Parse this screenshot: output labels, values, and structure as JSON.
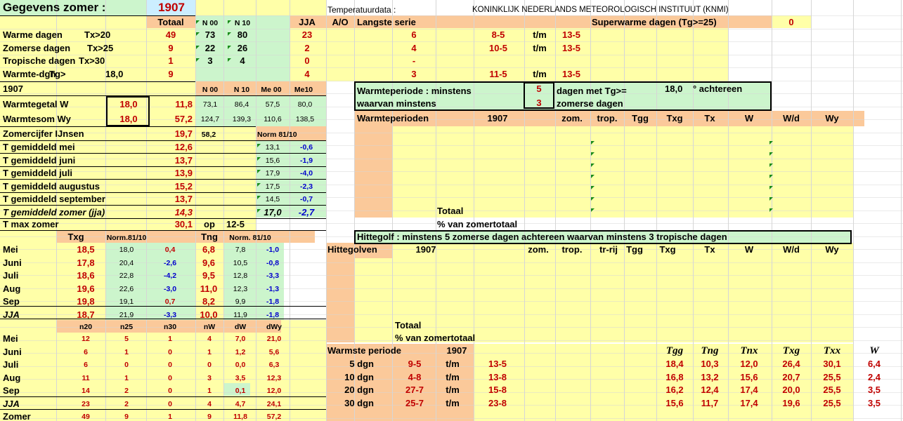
{
  "colors": {
    "yellow": "#ffffa8",
    "orange": "#fbc99a",
    "green": "#ccf5cc",
    "blue": "#cceeff",
    "red": "#c00000",
    "blue_text": "#0000cc"
  },
  "header": {
    "title": "Gegevens zomer :",
    "year": "1907",
    "temp_label": "Temperatuurdata :",
    "source": "KONINKLIJK NEDERLANDS METEOROLOGISCH INSTITUUT (KNMI)"
  },
  "col_heads": {
    "totaal": "Totaal",
    "n00": "N 00",
    "n10": "N 10",
    "jja": "JJA",
    "ao": "A/O",
    "langste": "Langste serie",
    "superwarm": "Superwarme dagen (Tg>=25)",
    "superwarm_val": "0"
  },
  "days": [
    {
      "label": "Warme dagen",
      "crit": "Tx>20",
      "tot": "49",
      "n00": "73",
      "n10": "80",
      "jja": "23",
      "ser": "6",
      "from": "8-5",
      "tm": "t/m",
      "to": "13-5"
    },
    {
      "label": "Zomerse dagen",
      "crit": "Tx>25",
      "tot": "9",
      "n00": "22",
      "n10": "26",
      "jja": "2",
      "ser": "4",
      "from": "10-5",
      "tm": "t/m",
      "to": "13-5"
    },
    {
      "label": "Tropische dagen",
      "crit": "Tx>30",
      "tot": "1",
      "n00": "3",
      "n10": "4",
      "jja": "0",
      "ser": "-",
      "from": "",
      "tm": "",
      "to": ""
    },
    {
      "label": "Warmte-dgn",
      "crit": "Tg>",
      "tot": "9",
      "n00": "",
      "n10": "",
      "jja": "4",
      "ser": "3",
      "from": "11-5",
      "tm": "t/m",
      "to": "13-5",
      "thr": "18,0"
    }
  ],
  "warmte": {
    "year": "1907",
    "h_n00": "N 00",
    "h_n10": "N 10",
    "h_me00": "Me 00",
    "h_me10": "Me10",
    "rows": [
      {
        "label": "Warmtegetal W",
        "box": "18,0",
        "val": "11,8",
        "n00": "73,1",
        "n10": "86,4",
        "me00": "57,5",
        "me10": "80,0"
      },
      {
        "label": "Warmtesom Wy",
        "box": "18,0",
        "val": "57,2",
        "n00": "124,7",
        "n10": "139,3",
        "me00": "110,6",
        "me10": "138,5"
      }
    ],
    "ijnsen_label": "Zomercijfer IJnsen",
    "ijnsen_val": "19,7",
    "ijnsen_n": "58,2",
    "norm": "Norm 81/10"
  },
  "tgem": [
    {
      "label": "T gemiddeld mei",
      "val": "12,6",
      "norm": "13,1",
      "diff": "-0,6"
    },
    {
      "label": "T gemiddeld juni",
      "val": "13,7",
      "norm": "15,6",
      "diff": "-1,9"
    },
    {
      "label": "T gemiddeld juli",
      "val": "13,9",
      "norm": "17,9",
      "diff": "-4,0"
    },
    {
      "label": "T gemiddeld augustus",
      "val": "15,2",
      "norm": "17,5",
      "diff": "-2,3"
    },
    {
      "label": "T gemiddeld september",
      "val": "13,7",
      "norm": "14,5",
      "diff": "-0,7"
    },
    {
      "label": "T gemiddeld zomer (jja)",
      "val": "14,3",
      "norm": "17,0",
      "diff": "-2,7"
    }
  ],
  "tmax": {
    "label": "T max zomer",
    "val": "30,1",
    "op": "op",
    "date": "12-5"
  },
  "monthly": {
    "h_txg": "Txg",
    "h_norm": "Norm.81/10",
    "h_tng": "Tng",
    "h_norm2": "Norm. 81/10",
    "rows": [
      {
        "m": "Mei",
        "txg": "18,5",
        "nx": "18,0",
        "dx": "0,4",
        "tng": "6,8",
        "nn": "7,8",
        "dn": "-1,0"
      },
      {
        "m": "Juni",
        "txg": "17,8",
        "nx": "20,4",
        "dx": "-2,6",
        "tng": "9,6",
        "nn": "10,5",
        "dn": "-0,8"
      },
      {
        "m": "Juli",
        "txg": "18,6",
        "nx": "22,8",
        "dx": "-4,2",
        "tng": "9,5",
        "nn": "12,8",
        "dn": "-3,3"
      },
      {
        "m": "Aug",
        "txg": "19,6",
        "nx": "22,6",
        "dx": "-3,0",
        "tng": "11,0",
        "nn": "12,3",
        "dn": "-1,3"
      },
      {
        "m": "Sep",
        "txg": "19,8",
        "nx": "19,1",
        "dx": "0,7",
        "tng": "8,2",
        "nn": "9,9",
        "dn": "-1,8"
      },
      {
        "m": "JJA",
        "txg": "18,7",
        "nx": "21,9",
        "dx": "-3,3",
        "tng": "10,0",
        "nn": "11,9",
        "dn": "-1,8"
      }
    ]
  },
  "counts": {
    "heads": [
      "n20",
      "n25",
      "n30",
      "nW",
      "dW",
      "dWy"
    ],
    "rows": [
      {
        "m": "Mei",
        "v": [
          "12",
          "5",
          "1",
          "4",
          "7,0",
          "21,0"
        ]
      },
      {
        "m": "Juni",
        "v": [
          "6",
          "1",
          "0",
          "1",
          "1,2",
          "5,6"
        ]
      },
      {
        "m": "Juli",
        "v": [
          "6",
          "0",
          "0",
          "0",
          "0,0",
          "6,3"
        ]
      },
      {
        "m": "Aug",
        "v": [
          "11",
          "1",
          "0",
          "3",
          "3,5",
          "12,3"
        ]
      },
      {
        "m": "Sep",
        "v": [
          "14",
          "2",
          "0",
          "1",
          "0,1",
          "12,0"
        ]
      },
      {
        "m": "JJA",
        "v": [
          "23",
          "2",
          "0",
          "4",
          "4,7",
          "24,1"
        ]
      },
      {
        "m": "Zomer",
        "v": [
          "49",
          "9",
          "1",
          "9",
          "11,8",
          "57,2"
        ]
      }
    ]
  },
  "wp_def": {
    "l1": "Warmteperiode : minstens",
    "v1": "5",
    "t1": "dagen met Tg>=",
    "thr": "18,0",
    "t1b": "° achtereen",
    "l2": "waarvan minstens",
    "v2": "3",
    "t2": "zomerse dagen"
  },
  "wp_table": {
    "title": "Warmteperioden",
    "year": "1907",
    "heads": [
      "zom.",
      "trop.",
      "Tgg",
      "Txg",
      "Tx",
      "W",
      "W/d",
      "Wy"
    ],
    "totaal": "Totaal",
    "pct": "% van zomertotaal"
  },
  "hittegolf": {
    "def": "Hittegolf : minstens  5 zomerse dagen achtereen waarvan minstens   3 tropische dagen",
    "title": "Hittegolven",
    "year": "1907",
    "heads": [
      "zom.",
      "trop.",
      "tr-rij",
      "Tgg",
      "Txg",
      "Tx",
      "W",
      "W/d",
      "Wy"
    ],
    "totaal": "Totaal",
    "pct": "% van zomertotaal"
  },
  "warmste": {
    "title": "Warmste periode",
    "year": "1907",
    "heads": [
      "Tgg",
      "Tng",
      "Tnx",
      "Txg",
      "Txx",
      "W"
    ],
    "rows": [
      {
        "p": "5 dgn",
        "from": "9-5",
        "tm": "t/m",
        "to": "13-5",
        "v": [
          "18,4",
          "10,3",
          "12,0",
          "26,4",
          "30,1",
          "6,4"
        ]
      },
      {
        "p": "10 dgn",
        "from": "4-8",
        "tm": "t/m",
        "to": "13-8",
        "v": [
          "16,8",
          "13,2",
          "15,6",
          "20,7",
          "25,5",
          "2,4"
        ]
      },
      {
        "p": "20 dgn",
        "from": "27-7",
        "tm": "t/m",
        "to": "15-8",
        "v": [
          "16,2",
          "12,4",
          "17,4",
          "20,0",
          "25,5",
          "3,5"
        ]
      },
      {
        "p": "30 dgn",
        "from": "25-7",
        "tm": "t/m",
        "to": "23-8",
        "v": [
          "15,6",
          "11,7",
          "17,4",
          "19,6",
          "25,5",
          "3,5"
        ]
      }
    ]
  }
}
